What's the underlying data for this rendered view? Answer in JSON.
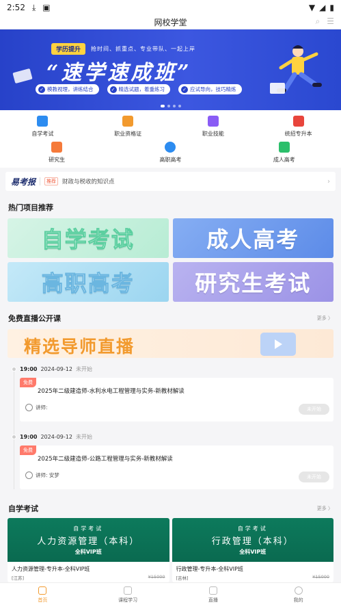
{
  "status_bar": {
    "time": "2:52"
  },
  "title_bar": {
    "title": "网校学堂"
  },
  "banner": {
    "tag": "学历提升",
    "tagline": "抢时间、抓重点、专业带队、一起上岸",
    "headline": "“速学速成班”",
    "pills": [
      "模教视理，讲练结合",
      "精选试题，着重练习",
      "应试导向，技巧精炼"
    ]
  },
  "categories_row1": [
    {
      "label": "自学考试",
      "icon": "book-icon",
      "color": "#2d8cf0"
    },
    {
      "label": "职业资格证",
      "icon": "certificate-icon",
      "color": "#f29a2e"
    },
    {
      "label": "职业技能",
      "icon": "skill-icon",
      "color": "#8a5cf5"
    },
    {
      "label": "统招专升本",
      "icon": "star-icon",
      "color": "#e8453c"
    }
  ],
  "categories_row2": [
    {
      "label": "研究生",
      "icon": "envelope-icon",
      "color": "#f57a3a"
    },
    {
      "label": "高职高考",
      "icon": "play-icon",
      "color": "#2d8cf0"
    },
    {
      "label": "成人高考",
      "icon": "tag-icon",
      "color": "#2cbf6b"
    }
  ],
  "news": {
    "brand": "易考报",
    "badge": "推荐",
    "text": "财政与税收的知识点"
  },
  "hot": {
    "title": "热门项目推荐",
    "tiles": [
      "自学考试",
      "成人高考",
      "高职高考",
      "研究生考试"
    ]
  },
  "live": {
    "title": "免费直播公开课",
    "more": "更多 〉",
    "banner_text": "精选导师直播",
    "items": [
      {
        "time": "19:00",
        "date": "2024-09-12",
        "status": "未开始",
        "free": "免费",
        "title": "2025年二级建造师-水利水电工程管理与实务-新教材解读",
        "teacher": "讲师:",
        "button": "未开始"
      },
      {
        "time": "19:00",
        "date": "2024-09-12",
        "status": "未开始",
        "free": "免费",
        "title": "2025年二级建造师-公路工程管理与实务-新教材解读",
        "teacher": "讲师: 安梦",
        "button": "未开始"
      }
    ]
  },
  "self_study": {
    "title": "自学考试",
    "more": "更多 〉",
    "courses": [
      {
        "cover_a": "自学考试",
        "cover_b": "人力资源管理（本科）",
        "cover_c": "全科VIP班",
        "title": "人力资源管理-专升本-全科VIP班",
        "meta": "[江苏]",
        "old_price": "¥15000"
      },
      {
        "cover_a": "自学考试",
        "cover_b": "行政管理（本科）",
        "cover_c": "全科VIP班",
        "title": "行政管理-专升本-全科VIP班",
        "meta": "[吉林]",
        "old_price": "¥15000"
      }
    ]
  },
  "tabbar": {
    "tabs": [
      {
        "label": "首页",
        "active": true
      },
      {
        "label": "课程学习",
        "active": false
      },
      {
        "label": "直播",
        "active": false
      },
      {
        "label": "我的",
        "active": false
      }
    ]
  }
}
